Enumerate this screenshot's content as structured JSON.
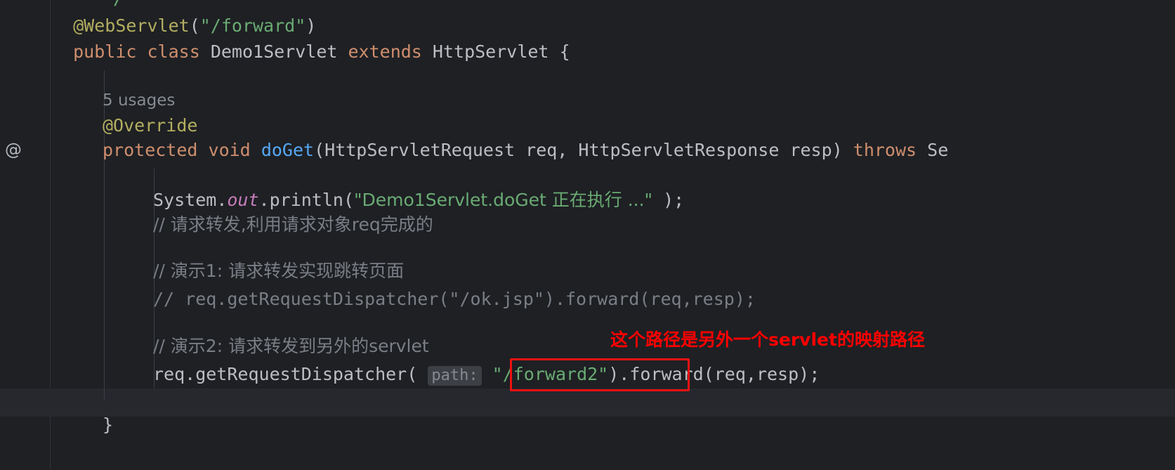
{
  "editor": {
    "theme_background": "#1e2024",
    "gutter_background": "#1e2024",
    "caret_line_background": "#26282e",
    "default_text_color": "#bcbec4",
    "gutter_icon": "@",
    "inlay_hint": "path:",
    "code_lines": [
      {
        "id": "l0",
        "text": "*/"
      },
      {
        "id": "l1",
        "text": "@WebServlet(\"/forward\")"
      },
      {
        "id": "l2",
        "text": "public class Demo1Servlet extends HttpServlet {"
      },
      {
        "id": "l3",
        "text": ""
      },
      {
        "id": "l4",
        "text": "5 usages"
      },
      {
        "id": "l5",
        "text": "@Override"
      },
      {
        "id": "l6",
        "text": "protected void doGet(HttpServletRequest req, HttpServletResponse resp) throws Se"
      },
      {
        "id": "l7",
        "text": ""
      },
      {
        "id": "l8",
        "text": "System.out.println(\"Demo1Servlet.doGet 正在执行 ...\" );"
      },
      {
        "id": "l9",
        "text": "// 请求转发,利用请求对象req完成的"
      },
      {
        "id": "l10",
        "text": ""
      },
      {
        "id": "l11",
        "text": "// 演示1: 请求转发实现跳转页面"
      },
      {
        "id": "l12",
        "text": "// req.getRequestDispatcher(\"/ok.jsp\").forward(req,resp);"
      },
      {
        "id": "l13",
        "text": ""
      },
      {
        "id": "l14",
        "text": "// 演示2: 请求转发到另外的servlet"
      },
      {
        "id": "l15",
        "text": "req.getRequestDispatcher( path: \"/forward2\").forward(req,resp);"
      },
      {
        "id": "l16",
        "text": ""
      },
      {
        "id": "l17",
        "text": "}"
      }
    ],
    "tokens": {
      "comment_block_end": "*/",
      "annotation_webservlet": "@WebServlet",
      "annotation_override": "@Override",
      "string_forward": "\"/forward\"",
      "kw_public": "public",
      "kw_class": "class",
      "kw_extends": "extends",
      "kw_protected": "protected",
      "kw_void": "void",
      "kw_throws": "throws",
      "type_demo1servlet": "Demo1Servlet",
      "type_httpservlet": "HttpServlet",
      "type_httpservletrequest": "HttpServletRequest",
      "type_httpservletresponse": "HttpServletResponse",
      "type_se_truncated": "Se",
      "param_req": "req",
      "param_resp": "resp",
      "method_doget": "doGet",
      "usages_label": "5 usages",
      "system_ident": "System",
      "out_field": "out",
      "println_method": "println",
      "string_doget_msg": "\"Demo1Servlet.doGet 正在执行 ...\"",
      "comment_forward_desc": "// 请求转发,利用请求对象req完成的",
      "comment_demo1": "// 演示1: 请求转发实现跳转页面",
      "comment_demo1_code": "// req.getRequestDispatcher(\"/ok.jsp\").forward(req,resp);",
      "comment_demo2": "// 演示2: 请求转发到另外的servlet",
      "call_req_dispatcher_prefix": "req.getRequestDispatcher(",
      "string_forward2": "\"/forward2\"",
      "call_forward_suffix": ").forward(req,resp);",
      "closing_brace": "}"
    }
  },
  "annotations": {
    "note_text": "这个路径是另外一个servlet的映射路径",
    "note_color": "#ff0000",
    "highlight_box_color": "#ee1111"
  }
}
